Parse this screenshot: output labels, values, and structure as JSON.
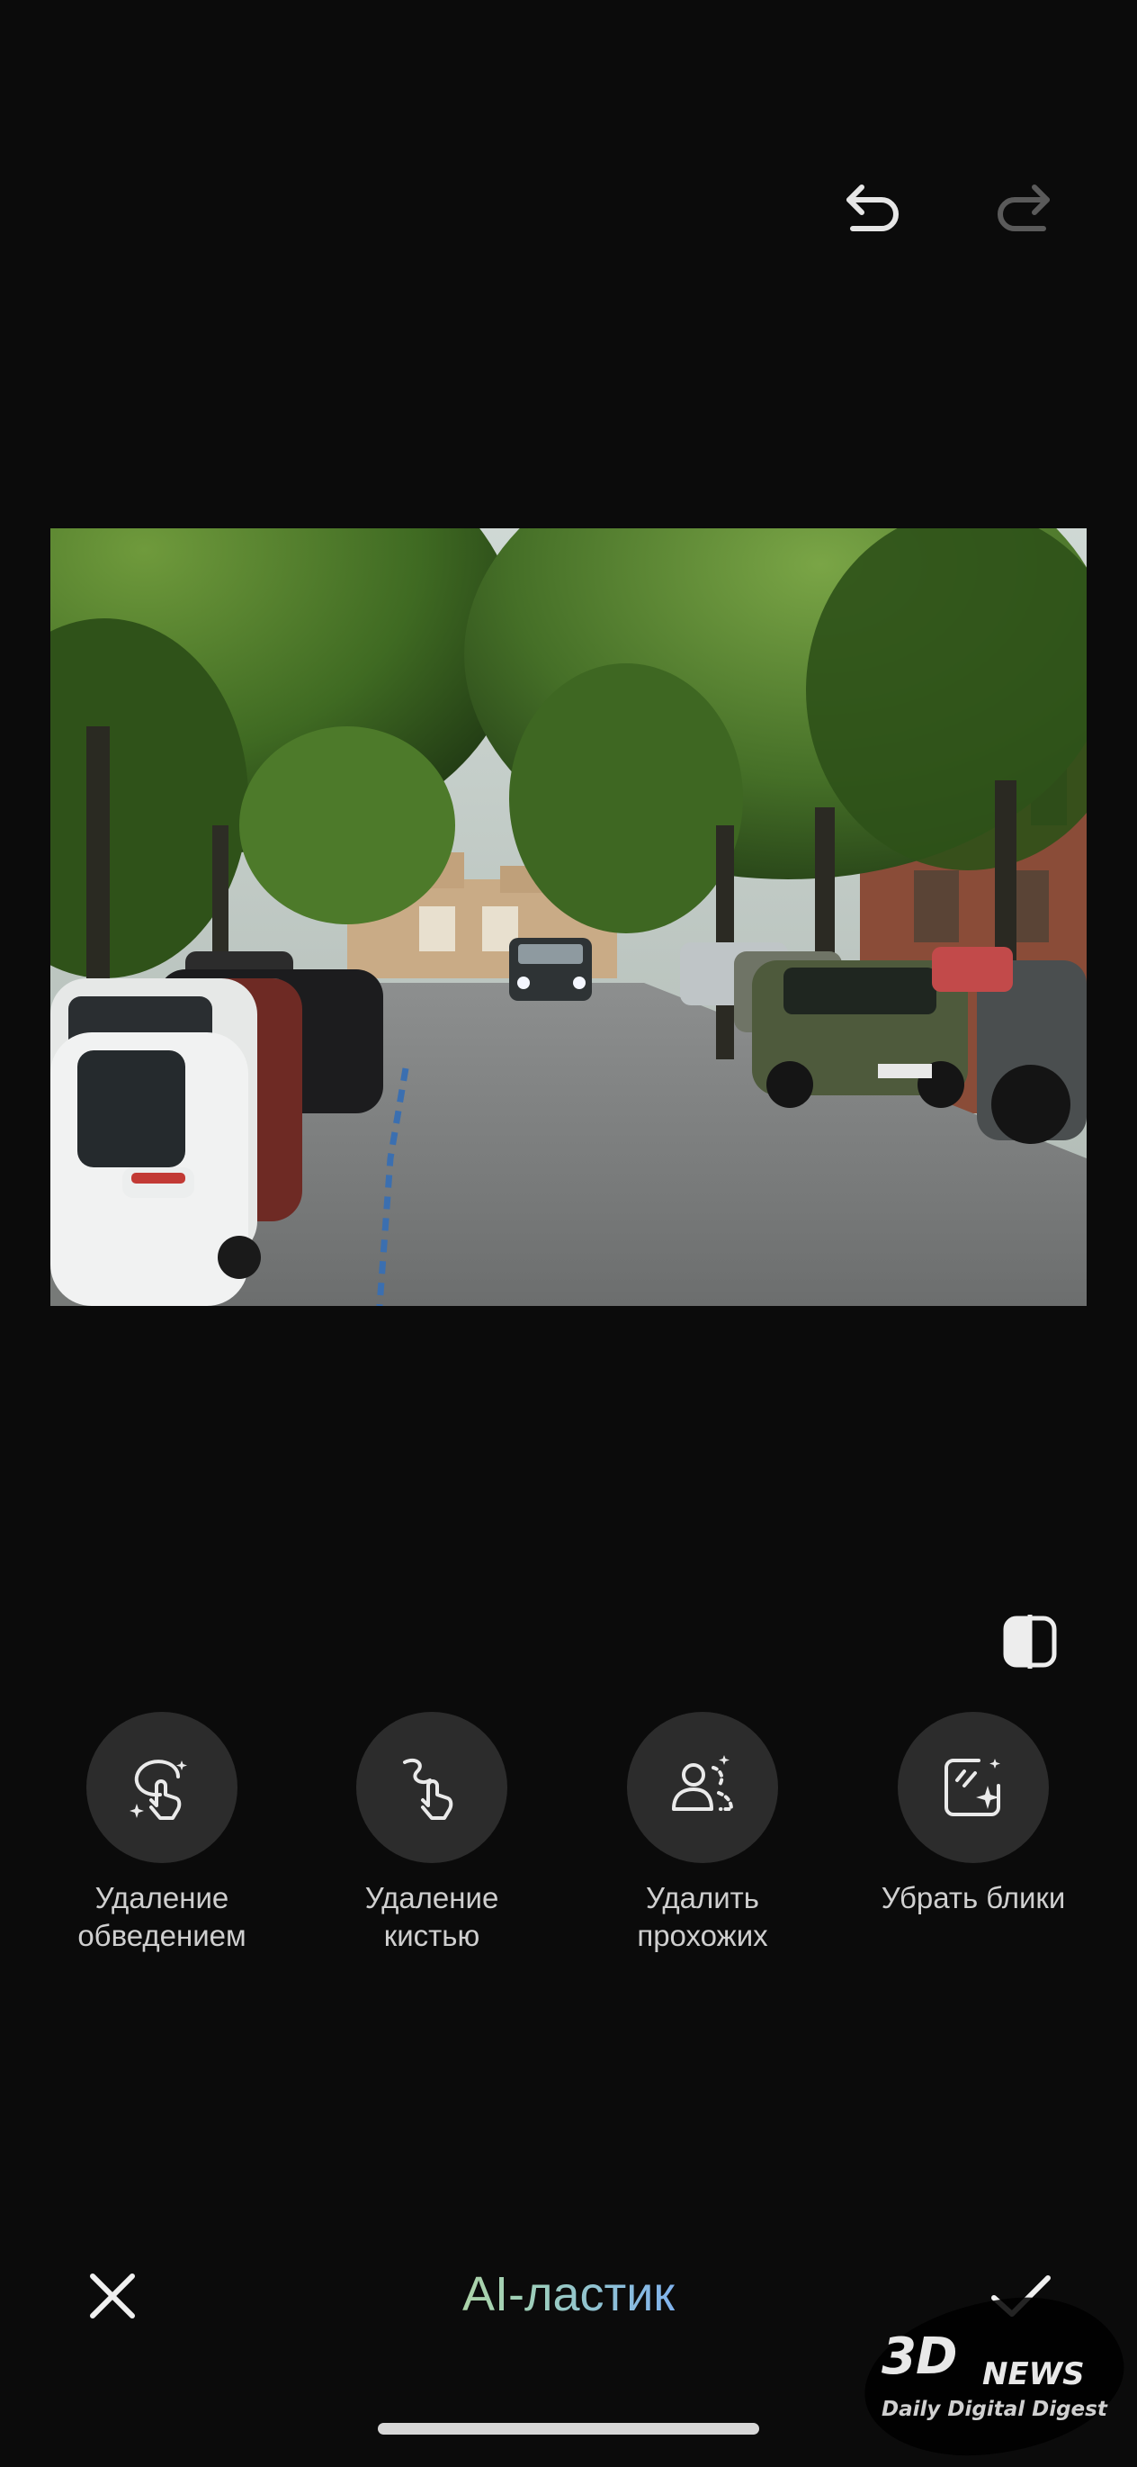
{
  "toolbar": {
    "undo_icon": "undo-arrow-icon",
    "redo_icon": "redo-arrow-icon",
    "redo_enabled": false
  },
  "photo": {
    "subject": "street-photo"
  },
  "compare": {
    "icon": "compare-split-icon"
  },
  "tools": [
    {
      "icon": "lasso-tap-icon",
      "label": "Удаление\nобведением"
    },
    {
      "icon": "brush-tap-icon",
      "label": "Удаление\nкистью"
    },
    {
      "icon": "remove-people-icon",
      "label": "Удалить\nпрохожих"
    },
    {
      "icon": "remove-glare-icon",
      "label": "Убрать блики"
    }
  ],
  "bottom_bar": {
    "title": "AI-ластик",
    "cancel_icon": "close-icon",
    "confirm_icon": "checkmark-icon"
  },
  "watermark": {
    "logo": "3D",
    "brand": "NEWS",
    "tagline": "Daily Digital Digest"
  },
  "colors": {
    "background": "#0b0b0b",
    "tool_circle": "#2c2c2c",
    "title_gradient_start": "#c6d98a",
    "title_gradient_end": "#8aa6ff"
  }
}
